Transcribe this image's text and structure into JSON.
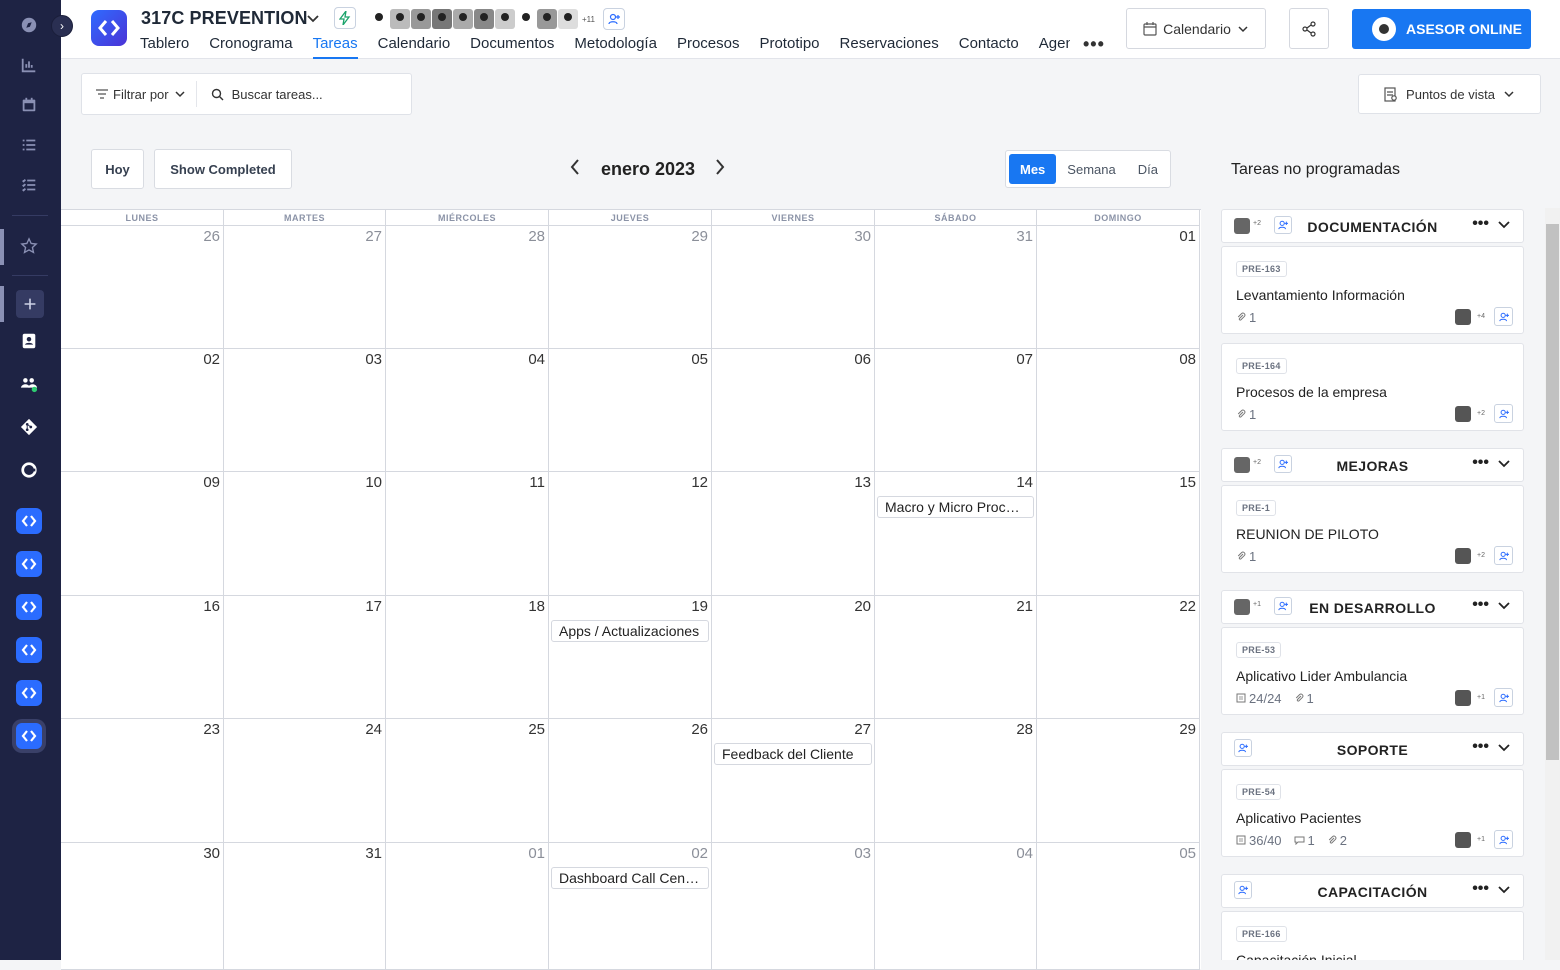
{
  "project": {
    "title": "317C PREVENTION",
    "members_more": "+11"
  },
  "tabs": [
    "Tablero",
    "Cronograma",
    "Tareas",
    "Calendario",
    "Documentos",
    "Metodología",
    "Procesos",
    "Prototipo",
    "Reservaciones",
    "Contacto",
    "Agenda"
  ],
  "active_tab": "Tareas",
  "header": {
    "calendar_btn": "Calendario",
    "asesor_btn": "ASESOR ONLINE"
  },
  "toolbar": {
    "filter": "Filtrar por",
    "search_placeholder": "Buscar tareas...",
    "points_of_view": "Puntos de vista"
  },
  "calendar": {
    "today": "Hoy",
    "show_completed": "Show Completed",
    "month_label": "enero 2023",
    "views": [
      "Mes",
      "Semana",
      "Día"
    ],
    "active_view": "Mes",
    "weekdays": [
      "LUNES",
      "MARTES",
      "MIÉRCOLES",
      "JUEVES",
      "VIERNES",
      "SÁBADO",
      "DOMINGO"
    ],
    "weeks": [
      [
        "26",
        "27",
        "28",
        "29",
        "30",
        "31",
        "01"
      ],
      [
        "02",
        "03",
        "04",
        "05",
        "06",
        "07",
        "08"
      ],
      [
        "09",
        "10",
        "11",
        "12",
        "13",
        "14",
        "15"
      ],
      [
        "16",
        "17",
        "18",
        "19",
        "20",
        "21",
        "22"
      ],
      [
        "23",
        "24",
        "25",
        "26",
        "27",
        "28",
        "29"
      ],
      [
        "30",
        "31",
        "01",
        "02",
        "03",
        "04",
        "05"
      ]
    ],
    "events": [
      {
        "week": 2,
        "day": 5,
        "title": "Macro y Micro Procesos"
      },
      {
        "week": 3,
        "day": 3,
        "title": "Apps / Actualizaciones"
      },
      {
        "week": 4,
        "day": 4,
        "title": "Feedback del Cliente"
      },
      {
        "week": 5,
        "day": 3,
        "title": "Dashboard Call Center"
      }
    ]
  },
  "unscheduled": {
    "title": "Tareas no programadas",
    "groups": [
      {
        "name": "DOCUMENTACIÓN",
        "members_more": "+2",
        "tasks": [
          {
            "code": "PRE-163",
            "title": "Levantamiento Información",
            "meta": [
              "1"
            ],
            "more": "+4"
          },
          {
            "code": "PRE-164",
            "title": "Procesos de la empresa",
            "meta": [
              "1"
            ],
            "more": "+2"
          }
        ]
      },
      {
        "name": "MEJORAS",
        "members_more": "+2",
        "tasks": [
          {
            "code": "PRE-1",
            "title": "REUNION DE PILOTO",
            "meta": [
              "1"
            ],
            "more": "+2"
          }
        ]
      },
      {
        "name": "EN DESARROLLO",
        "members_more": "+1",
        "tasks": [
          {
            "code": "PRE-53",
            "title": "Aplicativo Lider Ambulancia",
            "meta": [
              "24/24",
              "1"
            ],
            "more": "+1"
          }
        ]
      },
      {
        "name": "SOPORTE",
        "members_more": "",
        "tasks": [
          {
            "code": "PRE-54",
            "title": "Aplicativo Pacientes",
            "meta": [
              "36/40",
              "1",
              "2"
            ],
            "more": "+1"
          }
        ]
      },
      {
        "name": "CAPACITACIÓN",
        "members_more": "",
        "tasks": [
          {
            "code": "PRE-166",
            "title": "Capacitación Inicial",
            "meta": [],
            "more": ""
          }
        ]
      }
    ]
  },
  "colors": {
    "accent": "#1877f2",
    "rail": "#1e2344"
  }
}
